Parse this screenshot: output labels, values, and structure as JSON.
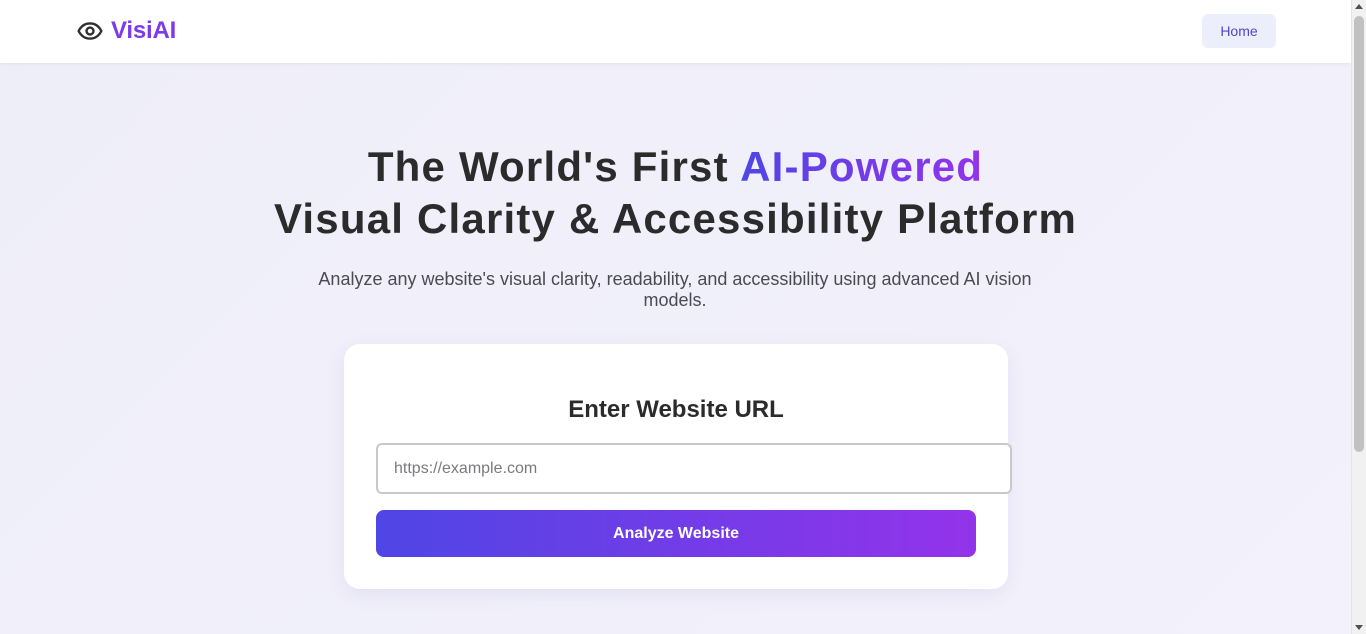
{
  "header": {
    "brand_name": "VisiAI",
    "brand_icon": "eye-icon",
    "nav": {
      "home_label": "Home"
    }
  },
  "hero": {
    "title_line1_prefix": "The World's First ",
    "title_line1_accent": "AI-Powered",
    "title_line2": "Visual Clarity & Accessibility Platform",
    "subtitle": "Analyze any website's visual clarity, readability, and accessibility using advanced AI vision models."
  },
  "url_card": {
    "title": "Enter Website URL",
    "input": {
      "value": "",
      "placeholder": "https://example.com"
    },
    "submit_label": "Analyze Website"
  },
  "colors": {
    "brand": "#7c3aed",
    "accent_gradient_start": "#4f46e5",
    "accent_gradient_end": "#9333ea",
    "nav_button_bg": "#eceefb",
    "page_bg": "#f1f0fa"
  }
}
